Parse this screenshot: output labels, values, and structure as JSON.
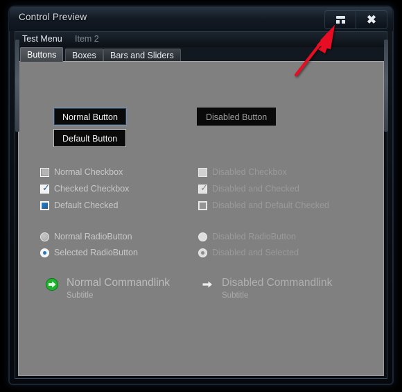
{
  "window": {
    "title": "Control Preview",
    "caption_buttons": [
      {
        "name": "restore-button",
        "icon": "restore-icon",
        "label": ""
      },
      {
        "name": "close-button",
        "icon": "close-icon",
        "label": "✖"
      }
    ]
  },
  "menubar": {
    "items": [
      {
        "label": "Test Menu",
        "enabled": true
      },
      {
        "label": "Item 2",
        "enabled": false
      }
    ]
  },
  "tabs": [
    {
      "label": "Buttons",
      "active": true
    },
    {
      "label": "Boxes",
      "active": false
    },
    {
      "label": "Bars and Sliders",
      "active": false
    }
  ],
  "buttons": [
    {
      "label": "Normal Button",
      "state": "focused"
    },
    {
      "label": "Default Button",
      "state": "default"
    },
    {
      "label": "Disabled Button",
      "state": "disabled"
    }
  ],
  "checkboxes": {
    "left": [
      {
        "label": "Normal Checkbox",
        "state": "unchecked"
      },
      {
        "label": "Checked Checkbox",
        "state": "checked"
      },
      {
        "label": "Default Checked",
        "state": "indeterminate"
      }
    ],
    "right": [
      {
        "label": "Disabled Checkbox",
        "state": "unchecked"
      },
      {
        "label": "Disabled and Checked",
        "state": "checked"
      },
      {
        "label": "Disabled and Default Checked",
        "state": "indeterminate"
      }
    ]
  },
  "radios": {
    "left": [
      {
        "label": "Normal RadioButton",
        "state": "unselected"
      },
      {
        "label": "Selected RadioButton",
        "state": "selected"
      }
    ],
    "right": [
      {
        "label": "Disabled RadioButton",
        "state": "unselected"
      },
      {
        "label": "Disabled and Selected",
        "state": "selected"
      }
    ]
  },
  "commandlinks": [
    {
      "title": "Normal Commandlink",
      "subtitle": "Subtitle",
      "icon": "green-arrow-circle-icon",
      "enabled": true
    },
    {
      "title": "Disabled Commandlink",
      "subtitle": "Subtitle",
      "icon": "gray-arrow-icon",
      "enabled": false
    }
  ],
  "annotation": {
    "type": "arrow",
    "color": "#e81123",
    "points_to": "restore-button"
  },
  "colors": {
    "accent_blue": "#1c79c6",
    "panel_gray": "#808080",
    "window_dark": "#0c1118",
    "annotation_red": "#e81123",
    "commandlink_green": "#1fb22e"
  }
}
